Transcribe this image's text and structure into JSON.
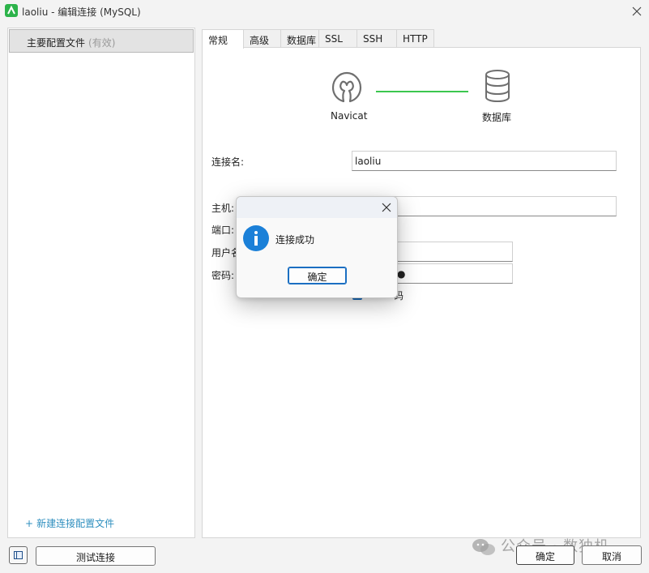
{
  "window": {
    "title": "laoliu - 编辑连接 (MySQL)",
    "close_glyph": "✕"
  },
  "sidebar": {
    "profile_name": "主要配置文件",
    "profile_status": "(有效)",
    "new_profile_plus": "+",
    "new_profile_label": "新建连接配置文件"
  },
  "tabs": [
    {
      "label": "常规",
      "active": true
    },
    {
      "label": "高级"
    },
    {
      "label": "数据库"
    },
    {
      "label": "SSL"
    },
    {
      "label": "SSH"
    },
    {
      "label": "HTTP"
    }
  ],
  "diagram": {
    "left_label": "Navicat",
    "right_label": "数据库",
    "line_color": "#3cc74f",
    "left_icon": "navicat-logo-icon",
    "right_icon": "database-icon"
  },
  "form": {
    "conn_name_label": "连接名:",
    "conn_name_value": "laoliu",
    "host_label": "主机:",
    "host_value": "",
    "port_label": "端口:",
    "user_label": "用户名:",
    "user_value": "",
    "password_label": "密码:",
    "password_value": "●",
    "save_password_label": "码"
  },
  "buttons": {
    "test": "测试连接",
    "ok": "确定",
    "cancel": "取消"
  },
  "watermark": {
    "text": "公众号 · 数独机"
  },
  "dialog": {
    "message": "连接成功",
    "ok": "确定",
    "icon": "info-icon",
    "close_glyph": "✕"
  },
  "colors": {
    "accent": "#1b80d8",
    "link": "#2f8fbf",
    "success_line": "#3cc74f"
  }
}
